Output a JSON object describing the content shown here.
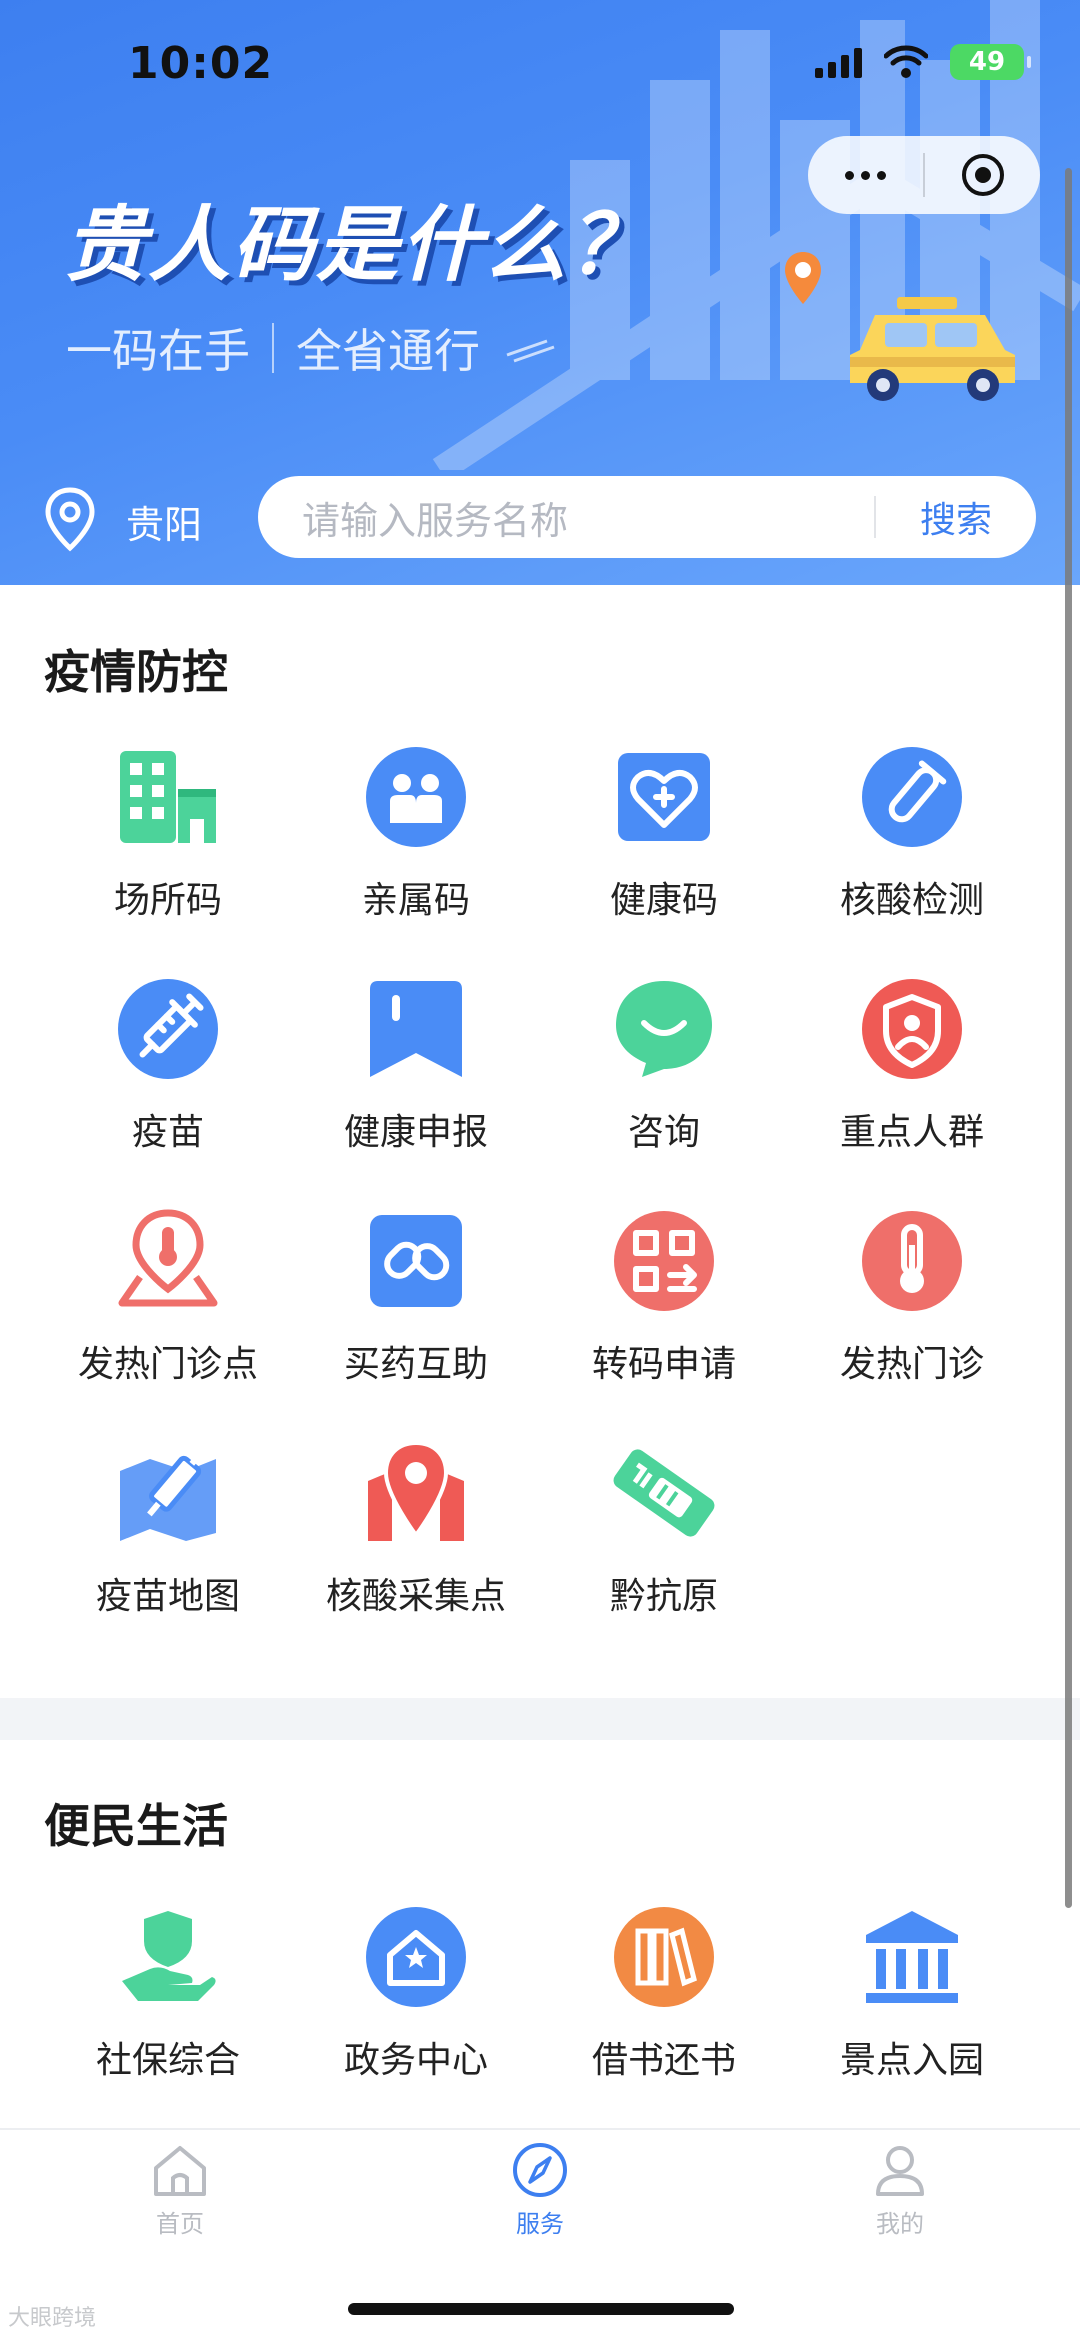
{
  "status": {
    "time": "10:02",
    "battery": "49"
  },
  "hero": {
    "title": "贵人码是什么？",
    "sub_left": "一码在手",
    "sub_right": "全省通行"
  },
  "search": {
    "city": "贵阳",
    "placeholder": "请输入服务名称",
    "button": "搜索"
  },
  "sections": {
    "epidemic": {
      "title": "疫情防控",
      "items": [
        {
          "label": "场所码",
          "icon": "building-icon",
          "color": "#4cd39a"
        },
        {
          "label": "亲属码",
          "icon": "family-icon",
          "color": "#4a8cf6"
        },
        {
          "label": "健康码",
          "icon": "heart-plus-icon",
          "color": "#4a8cf6"
        },
        {
          "label": "核酸检测",
          "icon": "test-tube-icon",
          "color": "#4a8cf6"
        },
        {
          "label": "疫苗",
          "icon": "syringe-icon",
          "color": "#4a8cf6"
        },
        {
          "label": "健康申报",
          "icon": "bookmark-icon",
          "color": "#4a8cf6"
        },
        {
          "label": "咨询",
          "icon": "chat-smile-icon",
          "color": "#4cd39a"
        },
        {
          "label": "重点人群",
          "icon": "person-shield-icon",
          "color": "#ef5a55"
        },
        {
          "label": "发热门诊点",
          "icon": "thermometer-pin-icon",
          "color": "#ef6f6a"
        },
        {
          "label": "买药互助",
          "icon": "pills-icon",
          "color": "#4a8cf6"
        },
        {
          "label": "转码申请",
          "icon": "qr-transfer-icon",
          "color": "#ef6f6a"
        },
        {
          "label": "发热门诊",
          "icon": "thermometer-icon",
          "color": "#ef6f6a"
        },
        {
          "label": "疫苗地图",
          "icon": "vaccine-map-icon",
          "color": "#4a8cf6"
        },
        {
          "label": "核酸采集点",
          "icon": "map-pin-icon",
          "color": "#ef5a55"
        },
        {
          "label": "黔抗原",
          "icon": "antigen-test-icon",
          "color": "#4cd39a"
        }
      ]
    },
    "life": {
      "title": "便民生活",
      "items": [
        {
          "label": "社保综合",
          "icon": "hand-shield-icon",
          "color": "#4cd39a"
        },
        {
          "label": "政务中心",
          "icon": "gov-house-icon",
          "color": "#4a8cf6"
        },
        {
          "label": "借书还书",
          "icon": "books-icon",
          "color": "#f28a44"
        },
        {
          "label": "景点入园",
          "icon": "museum-icon",
          "color": "#4a8cf6"
        }
      ]
    }
  },
  "tabbar": {
    "home": "首页",
    "service": "服务",
    "mine": "我的",
    "active_color": "#3d7ff0",
    "inactive_color": "#b9bcc2"
  },
  "watermark": "大眼跨境"
}
